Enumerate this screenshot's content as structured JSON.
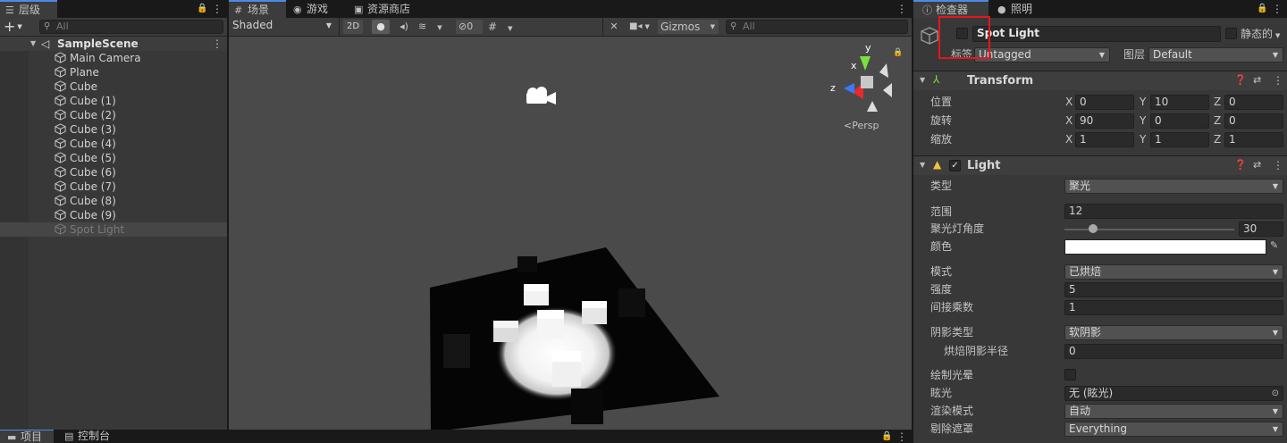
{
  "hierarchy": {
    "tab_label": "层级",
    "add_symbol": "+",
    "search_placeholder": "All",
    "scene_name": "SampleScene",
    "items": [
      {
        "label": "Main Camera",
        "disabled": false
      },
      {
        "label": "Plane",
        "disabled": false
      },
      {
        "label": "Cube",
        "disabled": false
      },
      {
        "label": "Cube (1)",
        "disabled": false
      },
      {
        "label": "Cube (2)",
        "disabled": false
      },
      {
        "label": "Cube (3)",
        "disabled": false
      },
      {
        "label": "Cube (4)",
        "disabled": false
      },
      {
        "label": "Cube (5)",
        "disabled": false
      },
      {
        "label": "Cube (6)",
        "disabled": false
      },
      {
        "label": "Cube (7)",
        "disabled": false
      },
      {
        "label": "Cube (8)",
        "disabled": false
      },
      {
        "label": "Cube (9)",
        "disabled": false
      },
      {
        "label": "Spot Light",
        "disabled": true
      }
    ]
  },
  "scene": {
    "tabs": [
      {
        "label": "场景",
        "icon": "grid-icon",
        "glyph": "#"
      },
      {
        "label": "游戏",
        "icon": "gamepad-icon",
        "glyph": "◉"
      },
      {
        "label": "资源商店",
        "icon": "store-bag-icon",
        "glyph": "▣"
      }
    ],
    "shading_mode": "Shaded",
    "mode_2d": "2D",
    "hidden_count": "0",
    "gizmos_label": "Gizmos",
    "search_placeholder": "All",
    "persp_label": "Persp",
    "gizmo_axes": {
      "y": "y",
      "x": "x",
      "z": "z"
    }
  },
  "inspector": {
    "tabs": [
      {
        "label": "检查器",
        "icon": "info-icon"
      },
      {
        "label": "照明",
        "icon": "bulb-icon"
      }
    ],
    "object_name": "Spot Light",
    "active_checked": false,
    "static_label": "静态的",
    "tag_label": "标签",
    "tag_value": "Untagged",
    "layer_label": "图层",
    "layer_value": "Default",
    "transform": {
      "title": "Transform",
      "rows": [
        {
          "label": "位置",
          "x": "0",
          "y": "10",
          "z": "0"
        },
        {
          "label": "旋转",
          "x": "90",
          "y": "0",
          "z": "0"
        },
        {
          "label": "缩放",
          "x": "1",
          "y": "1",
          "z": "1"
        }
      ],
      "axis_x": "X",
      "axis_y": "Y",
      "axis_z": "Z"
    },
    "light": {
      "title": "Light",
      "enabled": true,
      "type_label": "类型",
      "type_value": "聚光",
      "range_label": "范围",
      "range_value": "12",
      "spot_angle_label": "聚光灯角度",
      "spot_angle_value": "30",
      "spot_angle_fraction": 0.17,
      "color_label": "颜色",
      "color_value": "#ffffff",
      "mode_label": "模式",
      "mode_value": "已烘焙",
      "intensity_label": "强度",
      "intensity_value": "5",
      "indirect_label": "间接乘数",
      "indirect_value": "1",
      "shadow_type_label": "阴影类型",
      "shadow_type_value": "软阴影",
      "baked_radius_label": "烘焙阴影半径",
      "baked_radius_value": "0",
      "draw_halo_label": "绘制光晕",
      "draw_halo_checked": false,
      "flare_label": "眩光",
      "flare_value": "无 (眩光)",
      "render_mode_label": "渲染模式",
      "render_mode_value": "自动",
      "culling_label": "剔除遮罩",
      "culling_value": "Everything"
    }
  },
  "bottom": {
    "tabs": [
      {
        "label": "项目",
        "icon": "folder-icon"
      },
      {
        "label": "控制台",
        "icon": "console-icon"
      }
    ]
  },
  "colors": {
    "accent_blue": "#4d8ae6",
    "highlight_red": "#e8141c",
    "panel_bg": "#383838",
    "scene_bg": "#4a4a4a"
  }
}
